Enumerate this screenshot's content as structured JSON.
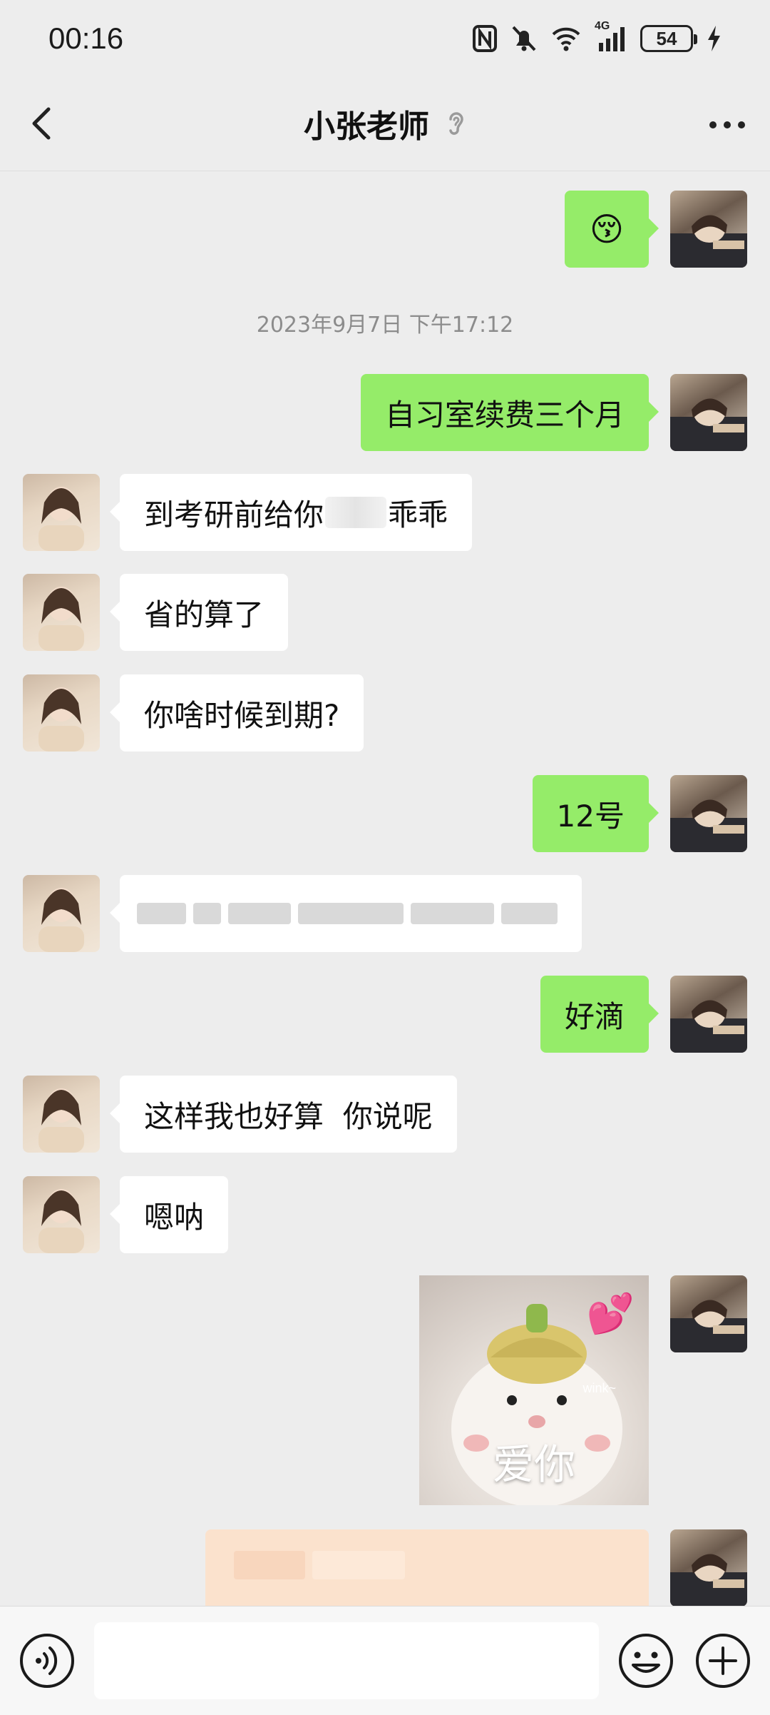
{
  "status_bar": {
    "time": "00:16",
    "network": "4G",
    "battery": "54"
  },
  "header": {
    "title": "小张老师"
  },
  "messages": {
    "m1_emoji": "😚",
    "timestamp": "2023年9月7日 下午17:12",
    "m2": "自习室续费三个月",
    "m3_start": "到考研前给你",
    "m3_end": "乖乖",
    "m4": "省的算了",
    "m5": "你啥时候到期?",
    "m6": "12号",
    "m8": "好滴",
    "m9": "这样我也好算  你说呢",
    "m10": "嗯呐",
    "sticker_caption": "爱你",
    "sticker_small": "wink~",
    "sticker_emoji": "💕"
  },
  "colors": {
    "background": "#ededed",
    "outgoing_bubble": "#95ec69",
    "incoming_bubble": "#ffffff",
    "timestamp_text": "#8c8c8c"
  },
  "icons": {
    "back": "chevron-left-icon",
    "ear": "ear-icon",
    "more": "more-dots-icon",
    "voice": "voice-icon",
    "emoji": "emoji-icon",
    "plus": "plus-icon"
  }
}
